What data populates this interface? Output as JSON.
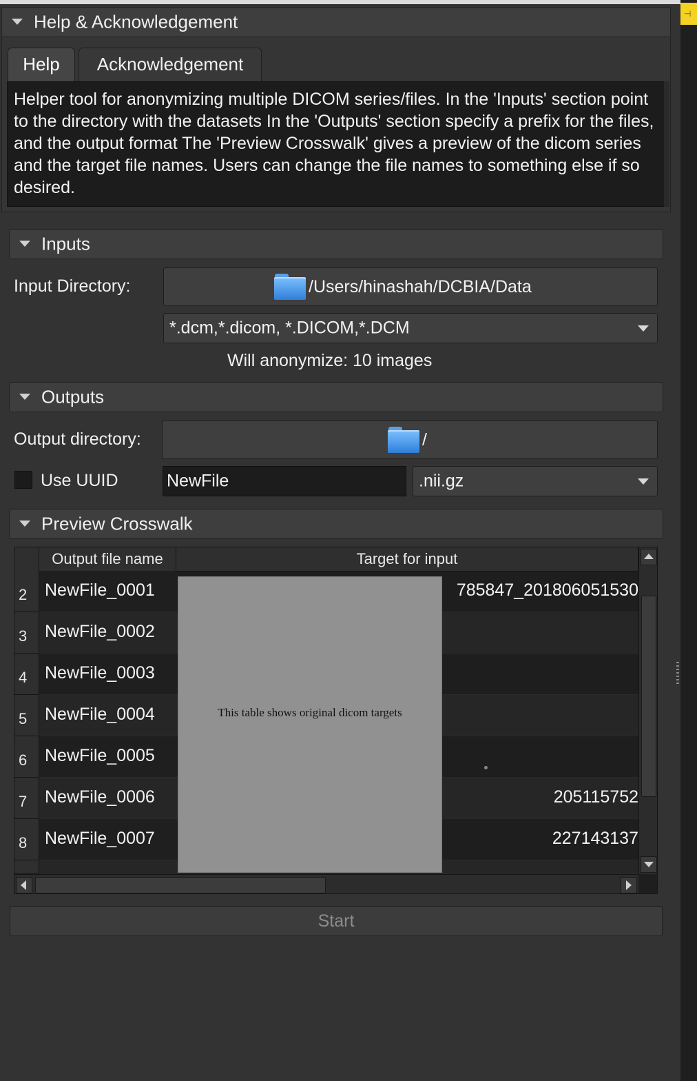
{
  "help_section": {
    "title": "Help & Acknowledgement",
    "tabs": [
      "Help",
      "Acknowledgement"
    ],
    "help_text": "Helper tool for anonymizing multiple DICOM series/files. In the 'Inputs' section point to the directory with the datasets In the 'Outputs' section specify a prefix for the files, and the output format The 'Preview Crosswalk' gives a preview of the dicom series and the target file names. Users can change the file names to something else if so desired."
  },
  "inputs": {
    "title": "Inputs",
    "input_directory_label": "Input Directory:",
    "input_directory_value": "/Users/hinashah/DCBIA/Data",
    "file_filter": "*.dcm,*.dicom, *.DICOM,*.DCM",
    "status": "Will anonymize: 10 images"
  },
  "outputs": {
    "title": "Outputs",
    "output_directory_label": "Output directory:",
    "output_directory_value": "/",
    "use_uuid_label": "Use UUID",
    "use_uuid_checked": false,
    "prefix_value": "NewFile",
    "format_value": ".nii.gz"
  },
  "preview": {
    "title": "Preview Crosswalk",
    "columns": [
      "Output file name",
      "Target for input"
    ],
    "rows": [
      {
        "num": "2",
        "name": "NewFile_0001",
        "target": "785847_201806051530"
      },
      {
        "num": "3",
        "name": "NewFile_0002",
        "target": ""
      },
      {
        "num": "4",
        "name": "NewFile_0003",
        "target": ""
      },
      {
        "num": "5",
        "name": "NewFile_0004",
        "target": ""
      },
      {
        "num": "6",
        "name": "NewFile_0005",
        "target": ""
      },
      {
        "num": "7",
        "name": "NewFile_0006",
        "target": "205115752"
      },
      {
        "num": "8",
        "name": "NewFile_0007",
        "target": "227143137"
      }
    ],
    "tooltip": "This table shows original dicom targets"
  },
  "start_label": "Start"
}
